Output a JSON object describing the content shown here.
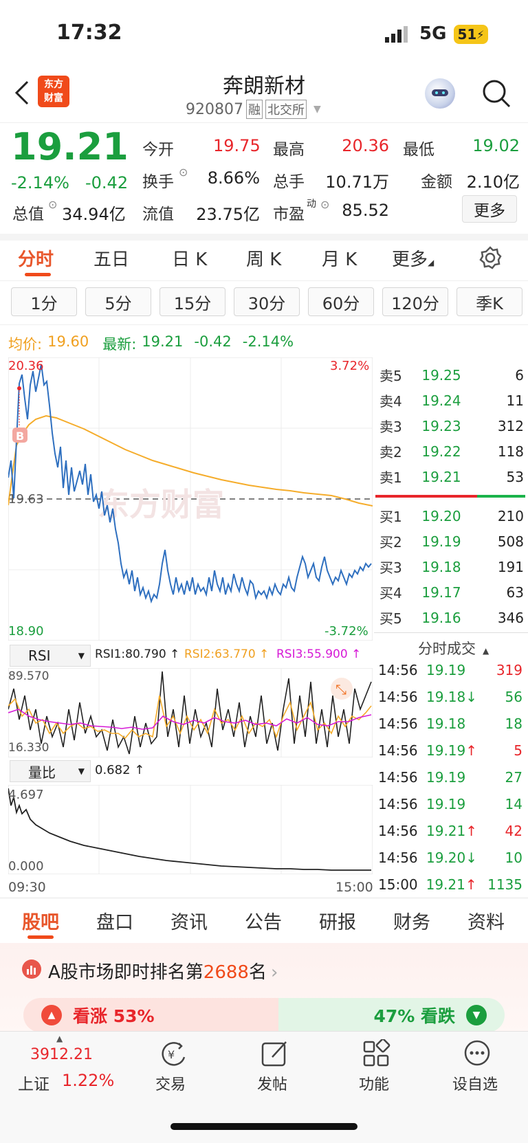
{
  "status_bar": {
    "time": "17:32",
    "network": "5G",
    "battery": "51"
  },
  "header": {
    "title": "奔朗新材",
    "code": "920807",
    "tag_margin": "融",
    "tag_exchange": "北交所",
    "logo_line1": "东方",
    "logo_line2": "财富"
  },
  "quote": {
    "price": "19.21",
    "change_pct": "-2.14%",
    "change": "-0.42",
    "open_label": "今开",
    "open": "19.75",
    "high_label": "最高",
    "high": "20.36",
    "low_label": "最低",
    "low": "19.02",
    "turnover_label": "换手",
    "turnover": "8.66%",
    "volume_label": "总手",
    "volume": "10.71万",
    "amount_label": "金额",
    "amount": "2.10亿",
    "mktcap_label": "总值",
    "mktcap": "34.94亿",
    "float_label": "流值",
    "float": "23.75亿",
    "pe_label": "市盈",
    "pe_sup": "动",
    "pe": "85.52",
    "more_button": "更多"
  },
  "chart_tabs": [
    "分时",
    "五日",
    "日 K",
    "周 K",
    "月 K",
    "更多"
  ],
  "period_buttons": [
    "1分",
    "5分",
    "15分",
    "30分",
    "60分",
    "120分",
    "季K"
  ],
  "info_line": {
    "avg_label": "均价:",
    "avg": "19.60",
    "latest_label": "最新:",
    "latest": "19.21",
    "change": "-0.42",
    "change_pct": "-2.14%"
  },
  "main_chart": {
    "y_top": "20.36",
    "y_mid": "19.63",
    "y_bottom": "18.90",
    "pct_top": "3.72%",
    "pct_bottom": "-3.72%",
    "buy_marker": "B",
    "watermark": "东方财富"
  },
  "rsi": {
    "selector": "RSI",
    "rsi1": "RSI1:80.790 ↑",
    "rsi2": "RSI2:63.770 ↑",
    "rsi3": "RSI3:55.900 ↑",
    "y_top": "89.570",
    "y_bottom": "16.330"
  },
  "volume_ratio": {
    "selector": "量比",
    "value": "0.682 ↑",
    "y_top": "4.697",
    "y_bottom": "0.000",
    "x_start": "09:30",
    "x_end": "15:00"
  },
  "order_book": {
    "asks": [
      {
        "label": "卖5",
        "price": "19.25",
        "vol": "6"
      },
      {
        "label": "卖4",
        "price": "19.24",
        "vol": "11"
      },
      {
        "label": "卖3",
        "price": "19.23",
        "vol": "312"
      },
      {
        "label": "卖2",
        "price": "19.22",
        "vol": "118"
      },
      {
        "label": "卖1",
        "price": "19.21",
        "vol": "53"
      }
    ],
    "bids": [
      {
        "label": "买1",
        "price": "19.20",
        "vol": "210"
      },
      {
        "label": "买2",
        "price": "19.19",
        "vol": "508"
      },
      {
        "label": "买3",
        "price": "19.18",
        "vol": "191"
      },
      {
        "label": "买4",
        "price": "19.17",
        "vol": "63"
      },
      {
        "label": "买5",
        "price": "19.16",
        "vol": "346"
      }
    ]
  },
  "ticks_title": "分时成交",
  "ticks": [
    {
      "time": "14:56",
      "price": "19.19",
      "arrow": "",
      "vol": "319",
      "color": "#e8262b"
    },
    {
      "time": "14:56",
      "price": "19.18",
      "arrow": "↓",
      "vol": "56",
      "color": "#1b9e3e"
    },
    {
      "time": "14:56",
      "price": "19.18",
      "arrow": "",
      "vol": "18",
      "color": "#1b9e3e"
    },
    {
      "time": "14:56",
      "price": "19.19",
      "arrow": "↑",
      "vol": "5",
      "color": "#e8262b"
    },
    {
      "time": "14:56",
      "price": "19.19",
      "arrow": "",
      "vol": "27",
      "color": "#1b9e3e"
    },
    {
      "time": "14:56",
      "price": "19.19",
      "arrow": "",
      "vol": "14",
      "color": "#1b9e3e"
    },
    {
      "time": "14:56",
      "price": "19.21",
      "arrow": "↑",
      "vol": "42",
      "color": "#e8262b"
    },
    {
      "time": "14:56",
      "price": "19.20",
      "arrow": "↓",
      "vol": "10",
      "color": "#1b9e3e"
    },
    {
      "time": "15:00",
      "price": "19.21",
      "arrow": "↑",
      "vol": "1135",
      "color": "#1b9e3e"
    }
  ],
  "bottom_tabs": [
    "股吧",
    "盘口",
    "资讯",
    "公告",
    "研报",
    "财务",
    "资料"
  ],
  "ranking": {
    "text": "A股市场即时排名第",
    "rank": "2688",
    "suffix": "名"
  },
  "sentiment": {
    "up_label": "看涨 53%",
    "down_label": "47% 看跌",
    "up_pct": 53
  },
  "index": {
    "value": "3912.21",
    "name": "上证",
    "change": "1.22%"
  },
  "bottom_nav": [
    "交易",
    "发帖",
    "功能",
    "设自选"
  ]
}
